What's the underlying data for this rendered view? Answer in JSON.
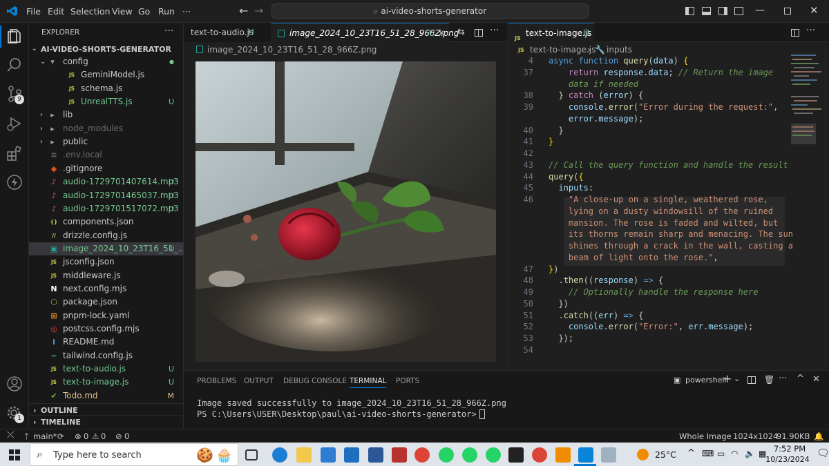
{
  "menu": [
    "File",
    "Edit",
    "Selection",
    "View",
    "Go",
    "Run",
    "···"
  ],
  "command_center": "ai-video-shorts-generator",
  "sidebar": {
    "title": "EXPLORER",
    "project": "AI-VIDEO-SHORTS-GENERATOR",
    "items": [
      {
        "label": "config",
        "type": "folder-open",
        "status": "●",
        "color": "#cccccc"
      },
      {
        "label": "GeminiModel.js",
        "type": "js",
        "status": "",
        "color": "#cccccc"
      },
      {
        "label": "schema.js",
        "type": "js",
        "status": "",
        "color": "#cccccc"
      },
      {
        "label": "UnrealTTS.js",
        "type": "js",
        "status": "U",
        "color": "#73c991"
      },
      {
        "label": "lib",
        "type": "folder",
        "status": "",
        "color": "#cccccc"
      },
      {
        "label": "node_modules",
        "type": "folder",
        "status": "",
        "color": "#6c6c6c"
      },
      {
        "label": "public",
        "type": "folder",
        "status": "",
        "color": "#cccccc"
      },
      {
        "label": ".env.local",
        "type": "env",
        "status": "",
        "color": "#6c6c6c"
      },
      {
        "label": ".gitignore",
        "type": "git",
        "status": "",
        "color": "#cccccc"
      },
      {
        "label": "audio-1729701407614.mp3",
        "type": "audio",
        "status": "U",
        "color": "#73c991"
      },
      {
        "label": "audio-1729701465037.mp3",
        "type": "audio",
        "status": "U",
        "color": "#73c991"
      },
      {
        "label": "audio-1729701517072.mp3",
        "type": "audio",
        "status": "U",
        "color": "#73c991"
      },
      {
        "label": "components.json",
        "type": "json",
        "status": "",
        "color": "#cccccc"
      },
      {
        "label": "drizzle.config.js",
        "type": "drizzle",
        "status": "",
        "color": "#cccccc"
      },
      {
        "label": "image_2024_10_23T16_51_...",
        "type": "image",
        "status": "U",
        "color": "#73c991"
      },
      {
        "label": "jsconfig.json",
        "type": "jsconfig",
        "status": "",
        "color": "#cccccc"
      },
      {
        "label": "middleware.js",
        "type": "js",
        "status": "",
        "color": "#cccccc"
      },
      {
        "label": "next.config.mjs",
        "type": "next",
        "status": "",
        "color": "#cccccc"
      },
      {
        "label": "package.json",
        "type": "npm",
        "status": "",
        "color": "#cccccc"
      },
      {
        "label": "pnpm-lock.yaml",
        "type": "yaml",
        "status": "",
        "color": "#cccccc"
      },
      {
        "label": "postcss.config.mjs",
        "type": "postcss",
        "status": "",
        "color": "#cccccc"
      },
      {
        "label": "README.md",
        "type": "info",
        "status": "",
        "color": "#cccccc"
      },
      {
        "label": "tailwind.config.js",
        "type": "tailwind",
        "status": "",
        "color": "#cccccc"
      },
      {
        "label": "text-to-audio.js",
        "type": "js",
        "status": "U",
        "color": "#73c991"
      },
      {
        "label": "text-to-image.js",
        "type": "js",
        "status": "U",
        "color": "#73c991"
      },
      {
        "label": "Todo.md",
        "type": "todo",
        "status": "M",
        "color": "#e2c08d"
      }
    ],
    "outline": "OUTLINE",
    "timeline": "TIMELINE"
  },
  "group1": {
    "tabs": [
      {
        "label": "text-to-audio.js",
        "status": "U"
      },
      {
        "label": "image_2024_10_23T16_51_28_966Z.png",
        "status": "U"
      }
    ],
    "breadcrumb": "image_2024_10_23T16_51_28_966Z.png"
  },
  "group2": {
    "tabs": [
      {
        "label": "text-to-image.js",
        "status": "U"
      }
    ],
    "breadcrumb": [
      "text-to-image.js",
      "inputs"
    ],
    "lines": [
      {
        "n": "4",
        "html": "<span class='kw'>async</span> <span class='kw'>function</span> <span class='fn'>query</span>(<span class='var'>data</span>) <span class='br'>{</span>"
      },
      {
        "n": "37",
        "html": "    <span class='kwc'>return</span> <span class='var'>response</span>.<span class='var'>data</span>; <span class='com'>// Return the image</span>"
      },
      {
        "n": "",
        "html": "    <span class='com'>data if needed</span>"
      },
      {
        "n": "38",
        "html": "  } <span class='kwc'>catch</span> (<span class='var'>error</span>) {"
      },
      {
        "n": "39",
        "html": "    <span class='var'>console</span>.<span class='fn'>error</span>(<span class='str'>\"Error during the request:\"</span>,"
      },
      {
        "n": "",
        "html": "    <span class='var'>error</span>.<span class='var'>message</span>);"
      },
      {
        "n": "40",
        "html": "  }"
      },
      {
        "n": "41",
        "html": "<span class='br'>}</span>"
      },
      {
        "n": "42",
        "html": ""
      },
      {
        "n": "43",
        "html": "<span class='com'>// Call the query function and handle the result</span>"
      },
      {
        "n": "44",
        "html": "<span class='fn'>query</span>(<span class='br'>{</span>"
      },
      {
        "n": "45",
        "html": "  <span class='var'>inputs</span>:"
      },
      {
        "n": "46",
        "html": "    <span class='str'>\"A close-up on a single, weathered rose,</span>"
      },
      {
        "n": "",
        "html": "    <span class='str'>lying on a dusty windowsill of the ruined</span>"
      },
      {
        "n": "",
        "html": "    <span class='str'>mansion. The rose is faded and wilted, but</span>"
      },
      {
        "n": "",
        "html": "    <span class='str'>its thorns remain sharp and menacing. The sun</span>"
      },
      {
        "n": "",
        "html": "    <span class='str'>shines through a crack in the wall, casting a</span>"
      },
      {
        "n": "",
        "html": "    <span class='str'>beam of light onto the rose.\"</span>,"
      },
      {
        "n": "47",
        "html": "<span class='br'>}</span>)"
      },
      {
        "n": "48",
        "html": "  .<span class='fn'>then</span>((<span class='var'>response</span>) <span class='kw'>=&gt;</span> {"
      },
      {
        "n": "49",
        "html": "    <span class='com'>// Optionally handle the response here</span>"
      },
      {
        "n": "50",
        "html": "  })"
      },
      {
        "n": "51",
        "html": "  .<span class='fn'>catch</span>((<span class='var'>err</span>) <span class='kw'>=&gt;</span> {"
      },
      {
        "n": "52",
        "html": "    <span class='var'>console</span>.<span class='fn'>error</span>(<span class='str'>\"Error:\"</span>, <span class='var'>err</span>.<span class='var'>message</span>);"
      },
      {
        "n": "53",
        "html": "  });"
      },
      {
        "n": "54",
        "html": ""
      }
    ]
  },
  "panel": {
    "tabs": [
      "PROBLEMS",
      "OUTPUT",
      "DEBUG CONSOLE",
      "TERMINAL",
      "PORTS"
    ],
    "active": "TERMINAL",
    "shell": "powershell",
    "output": [
      "Image saved successfully to image_2024_10_23T16_51_28_966Z.png",
      "PS C:\\Users\\USER\\Desktop\\paul\\ai-video-shorts-generator>"
    ]
  },
  "status": {
    "branch": "main*",
    "errors": "0",
    "warnings": "0",
    "ports": "0",
    "preview": "Whole Image",
    "dims": "1024x1024",
    "size": "91.90KB"
  },
  "taskbar": {
    "search": "Type here to search",
    "temp": "25°C",
    "time": "7:52 PM",
    "date": "10/23/2024"
  },
  "colors": {
    "accent": "#0078d4",
    "untracked": "#73c991",
    "modified": "#e2c08d"
  }
}
